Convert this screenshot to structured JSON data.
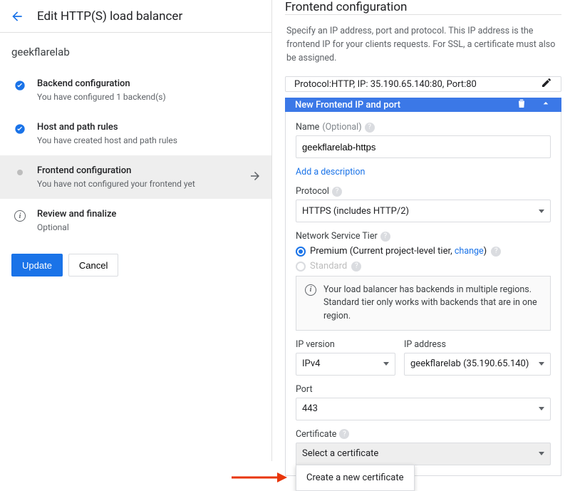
{
  "header": {
    "title": "Edit HTTP(S) load balancer",
    "lb_name": "geekflarelab"
  },
  "steps": {
    "backend": {
      "title": "Backend configuration",
      "sub": "You have configured 1 backend(s)"
    },
    "host": {
      "title": "Host and path rules",
      "sub": "You have created host and path rules"
    },
    "frontend": {
      "title": "Frontend configuration",
      "sub": "You have not configured your frontend yet"
    },
    "review": {
      "title": "Review and finalize",
      "sub": "Optional"
    }
  },
  "buttons": {
    "update": "Update",
    "cancel": "Cancel"
  },
  "right": {
    "title": "Frontend configuration",
    "desc": "Specify an IP address, port and protocol. This IP address is the frontend IP for your clients requests. For SSL, a certificate must also be assigned.",
    "summary": "Protocol:HTTP, IP: 35.190.65.140:80, Port:80",
    "panel_title": "New Frontend IP and port",
    "name_label": "Name",
    "optional": "(Optional)",
    "name_value": "geekflarelab-https",
    "add_desc": "Add a description",
    "protocol_label": "Protocol",
    "protocol_value": "HTTPS (includes HTTP/2)",
    "tier_label": "Network Service Tier",
    "tier_premium": "Premium (Current project-level tier, ",
    "tier_change": "change",
    "tier_premium_end": ")",
    "tier_standard": "Standard",
    "notice": "Your load balancer has backends in multiple regions. Standard tier only works with backends that are in one region.",
    "ipver_label": "IP version",
    "ipver_value": "IPv4",
    "ipaddr_label": "IP address",
    "ipaddr_value": "geekflarelab (35.190.65.140)",
    "port_label": "Port",
    "port_value": "443",
    "cert_label": "Certificate",
    "cert_value": "Select a certificate",
    "cert_option": "Create a new certificate"
  }
}
